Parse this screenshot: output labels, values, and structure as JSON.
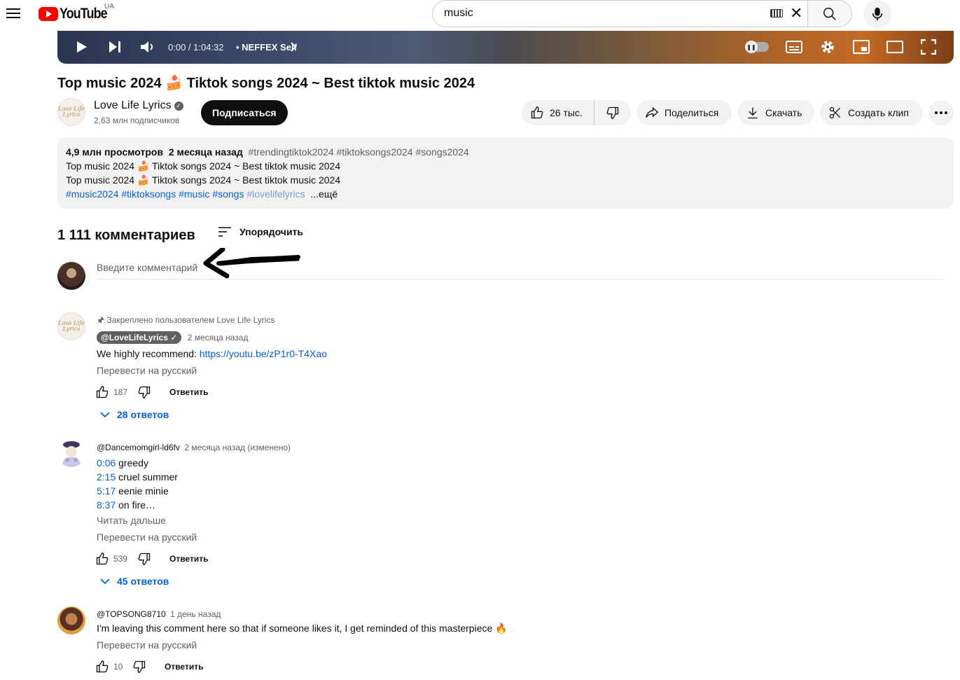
{
  "masthead": {
    "logo_text": "YouTube",
    "region": "UA",
    "search_value": "music",
    "icons": [
      "menu-icon",
      "keyboard-icon",
      "clear-icon",
      "search-icon",
      "mic-icon"
    ]
  },
  "player": {
    "time": "0:00 / 1:04:32",
    "chapter": "• NEFFEX Self",
    "icons": [
      "play-icon",
      "next-icon",
      "volume-icon",
      "autoplay-toggle",
      "subtitles-icon",
      "settings-icon",
      "miniplayer-icon",
      "theater-icon",
      "fullscreen-icon"
    ]
  },
  "video": {
    "title": "Top music 2024 🍰 Tiktok songs 2024 ~ Best tiktok music 2024",
    "channel_name": "Love Life Lyrics",
    "channel_avatar_text": "Love Life Lyrics",
    "subscribers": "2,63 млн подписчиков",
    "subscribe_label": "Подписаться",
    "likes": "26 тыс.",
    "share_label": "Поделиться",
    "download_label": "Скачать",
    "clip_label": "Создать клип"
  },
  "description": {
    "views": "4,9 млн просмотров",
    "date": "2 месяца назад",
    "top_tags": "#trendingtiktok2024 #tiktoksongs2024 #songs2024",
    "line1": "Top music 2024 🍰 Tiktok songs 2024 ~ Best tiktok music 2024",
    "line2": "Top music 2024 🍰 Tiktok songs 2024 ~ Best tiktok music 2024",
    "bottom_tags": "#music2024 #tiktoksongs #music #songs",
    "bottom_tag_faded": "#lovelifelyrics",
    "more_label": "...ещё"
  },
  "comments_section": {
    "count": "1 111 комментариев",
    "sort_label": "Упорядочить",
    "input_placeholder": "Введите комментарий"
  },
  "comments": [
    {
      "pinned_label": "Закреплено пользователем Love Life Lyrics",
      "author": "@LoveLifeLyrics",
      "time": "2 месяца назад",
      "text_prefix": "We highly recommend: ",
      "text_link": "https://youtu.be/zP1r0-T4Xao",
      "translate": "Перевести на русский",
      "likes": "187",
      "reply": "Ответить",
      "replies": "28 ответов"
    },
    {
      "author": "@Dancemomgirl-ld6fv",
      "time": "2 месяца назад (изменено)",
      "lines": [
        {
          "ts": "0:06",
          "text": " greedy"
        },
        {
          "ts": "2:15",
          "text": " cruel summer"
        },
        {
          "ts": "5:17",
          "text": " eenie minie"
        },
        {
          "ts": "8:37",
          "text": " on fire…"
        }
      ],
      "read_more": "Читать дальше",
      "translate": "Перевести на русский",
      "likes": "539",
      "reply": "Ответить",
      "replies": "45 ответов"
    },
    {
      "author": "@TOPSONG8710",
      "time": "1 день назад",
      "text": "I'm leaving this comment here so that if someone likes it, I get reminded of this masterpiece 🔥",
      "translate": "Перевести на русский",
      "likes": "10",
      "reply": "Ответить"
    }
  ],
  "colors": {
    "brand_red": "#ff0000",
    "link_blue": "#065fd4",
    "pill_bg": "#f2f2f2",
    "text_secondary": "#606060"
  }
}
